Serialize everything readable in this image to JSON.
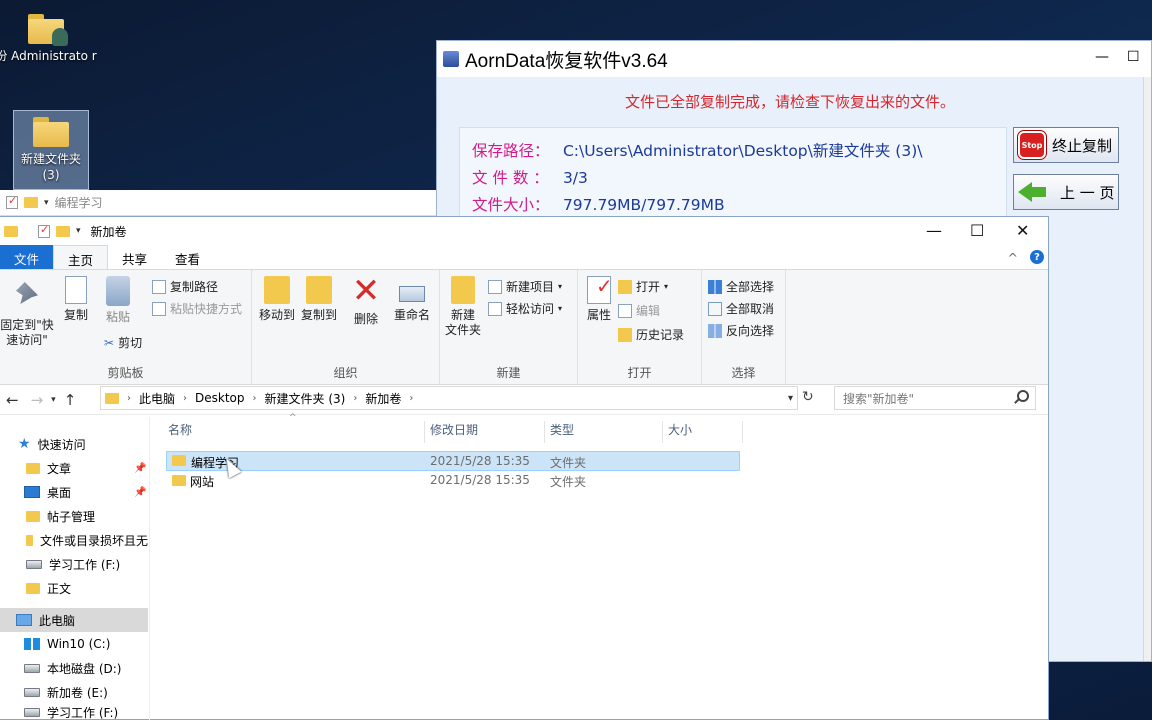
{
  "desktop": {
    "icons": [
      {
        "label": "份 Administrato r"
      },
      {
        "label": "新建文件夹 (3)"
      }
    ]
  },
  "bg_explorer": {
    "title": "编程学习"
  },
  "aorn": {
    "title": "AornData恢复软件v3.64",
    "message": "文件已全部复制完成，请检查下恢复出来的文件。",
    "save_path_label": "保存路径：",
    "save_path": "C:\\Users\\Administrator\\Desktop\\新建文件夹 (3)\\",
    "file_count_label": "文 件 数 ：",
    "file_count": "3/3",
    "file_size_label": "文件大小：",
    "file_size": "797.79MB/797.79MB",
    "stop_button": "终止复制",
    "stop_icon_text": "Stop",
    "back_button": "上 一 页",
    "controls": {
      "minimize": "—",
      "maximize": "☐"
    }
  },
  "explorer": {
    "title": "新加卷",
    "controls": {
      "minimize": "—",
      "maximize": "☐",
      "close": "✕"
    },
    "tabs": {
      "file": "文件",
      "home": "主页",
      "share": "共享",
      "view": "查看"
    },
    "help_caret": "^",
    "help": "?",
    "ribbon": {
      "clipboard": {
        "label": "剪贴板",
        "pin": "固定到\"快速访问\"",
        "copy": "复制",
        "paste": "粘贴",
        "copy_path": "复制路径",
        "paste_shortcut": "粘贴快捷方式",
        "cut": "剪切"
      },
      "organize": {
        "label": "组织",
        "move_to": "移动到",
        "copy_to": "复制到",
        "delete": "删除",
        "rename": "重命名"
      },
      "new": {
        "label": "新建",
        "new_folder": "新建\n文件夹",
        "new_item": "新建项目",
        "easy_access": "轻松访问"
      },
      "open": {
        "label": "打开",
        "properties": "属性",
        "open": "打开",
        "edit": "编辑",
        "history": "历史记录"
      },
      "select": {
        "label": "选择",
        "select_all": "全部选择",
        "select_none": "全部取消",
        "invert": "反向选择"
      }
    },
    "address": {
      "crumbs": [
        "此电脑",
        "Desktop",
        "新建文件夹 (3)",
        "新加卷"
      ],
      "search_placeholder": "搜索\"新加卷\""
    },
    "nav": {
      "quick_access": "快速访问",
      "items": [
        "文章",
        "桌面",
        "帖子管理",
        "文件或目录损坏且无",
        "学习工作 (F:)",
        "正文"
      ],
      "this_pc": "此电脑",
      "drives": [
        "Win10 (C:)",
        "本地磁盘 (D:)",
        "新加卷 (E:)",
        "学习工作 (F:)"
      ]
    },
    "columns": {
      "name": "名称",
      "date": "修改日期",
      "type": "类型",
      "size": "大小"
    },
    "files": [
      {
        "name": "编程学习",
        "date": "2021/5/28 15:35",
        "type": "文件夹"
      },
      {
        "name": "网站",
        "date": "2021/5/28 15:35",
        "type": "文件夹"
      }
    ]
  }
}
